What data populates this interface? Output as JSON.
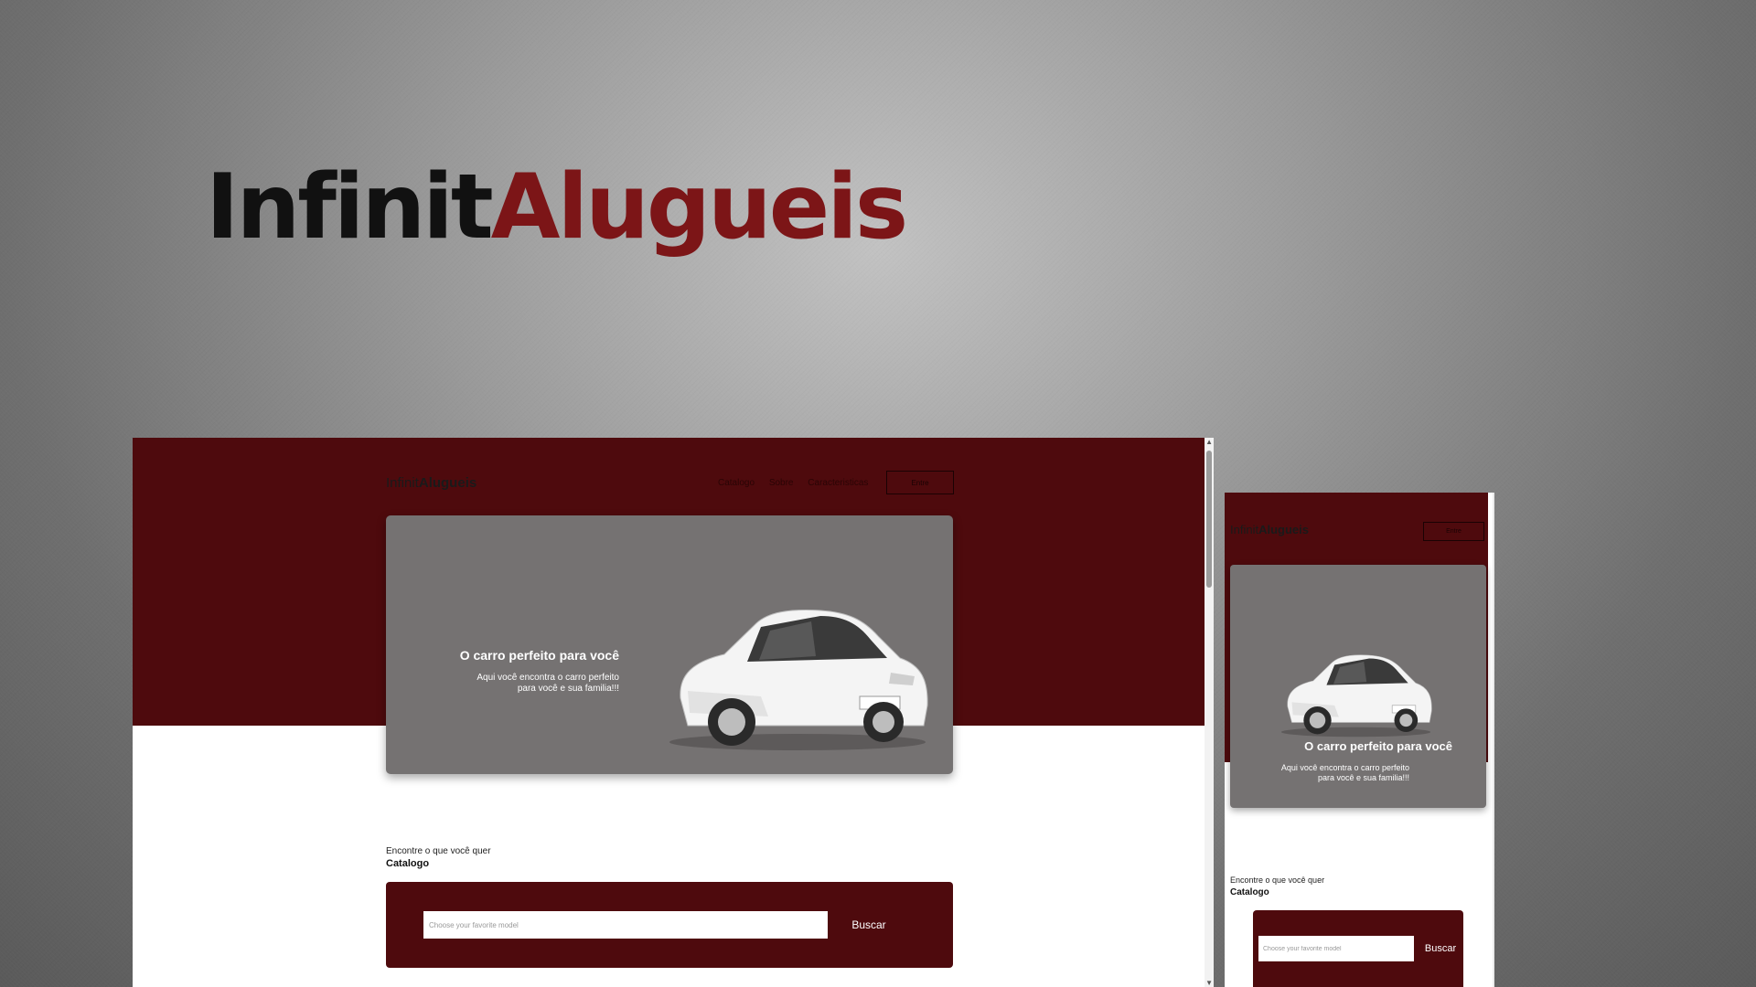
{
  "brand": {
    "part1": "Infinit",
    "part2": "Alugueis",
    "accent_color": "#7c1517",
    "band_color": "#4e0a0d"
  },
  "desktop": {
    "nav": {
      "logo_part1": "Infinit",
      "logo_part2": "Alugueis",
      "links": [
        "Catalogo",
        "Sobre",
        "Caracteristicas"
      ],
      "enter": "Entre"
    },
    "hero": {
      "title": "O carro perfeito para você",
      "text_line1": "Aqui você encontra o carro perfeito",
      "text_line2": "para você e sua familia!!!",
      "image_icon": "car-image-icon"
    },
    "catalog": {
      "subtitle": "Encontre o que você quer",
      "title": "Catalogo",
      "search_placeholder": "Choose your favorite model",
      "search_button": "Buscar"
    }
  },
  "mobile": {
    "nav": {
      "logo_part1": "Infinit",
      "logo_part2": "Alugueis",
      "enter": "Entre"
    },
    "hero": {
      "title": "O carro perfeito para você",
      "text_line1": "Aqui você encontra o carro perfeito",
      "text_line2": "para você e sua familia!!!",
      "image_icon": "car-image-icon"
    },
    "catalog": {
      "subtitle": "Encontre o que você quer",
      "title": "Catalogo",
      "search_placeholder": "Choose your favorite model",
      "search_button": "Buscar"
    }
  }
}
